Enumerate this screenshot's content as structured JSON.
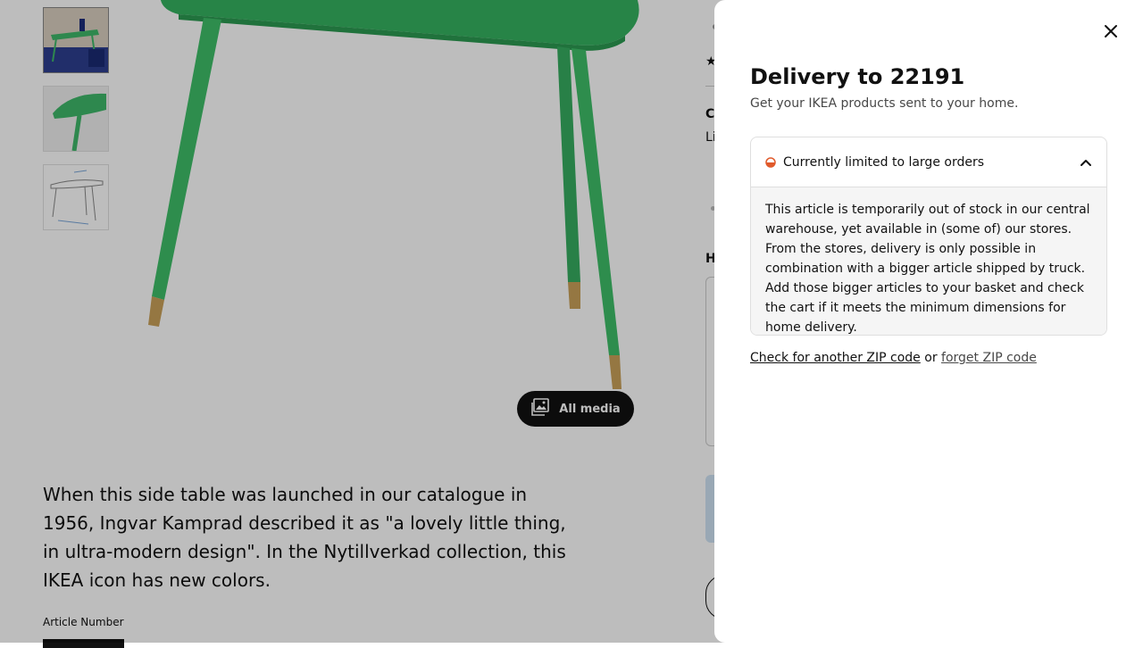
{
  "product": {
    "all_media_label": "All media",
    "description": "When this side table was launched in our catalogue in 1956, Ingvar Kamprad described it as \"a lovely little thing, in ultra-modern design\". In the Nytillverkad collection, this IKEA icon has new colors.",
    "article_number_label": "Article Number",
    "right_column": {
      "heading_c": "C",
      "text_li": "Li",
      "heading_h": "H"
    }
  },
  "delivery_sheet": {
    "title": "Delivery to 22191",
    "subtitle": "Get your IKEA products sent to your home.",
    "status": {
      "label": "Currently limited to large orders",
      "color": "#e05a2b",
      "expanded": true,
      "details": "This article is temporarily out of stock in our central warehouse, yet available in (some of) our stores. From the stores, delivery is only possible in combination with a bigger article shipped by truck. Add those bigger articles to your basket and check the cart if it meets the minimum dimensions for home delivery."
    },
    "check_zip_link": "Check for another ZIP code",
    "or_text": " or ",
    "forget_zip_link": "forget ZIP code"
  },
  "colors": {
    "table_green": "#3fb86a",
    "brass_leg_tip": "#c9a15a",
    "overlay": "rgba(0,0,0,0.26)"
  },
  "icons": [
    "close-icon",
    "chevron-up-icon",
    "half-circle-status-icon",
    "gallery-icon",
    "star-icon"
  ]
}
